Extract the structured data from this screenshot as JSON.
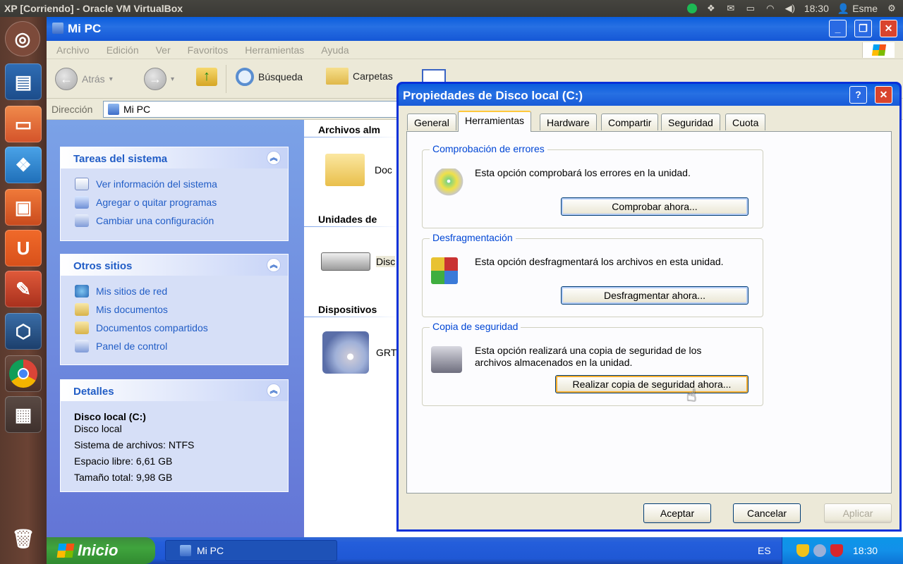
{
  "host": {
    "window_title": "XP [Corriendo] - Oracle VM VirtualBox",
    "clock": "18:30",
    "user": "Esme"
  },
  "explorer": {
    "title": "Mi PC",
    "menu": [
      "Archivo",
      "Edición",
      "Ver",
      "Favoritos",
      "Herramientas",
      "Ayuda"
    ],
    "toolbar": {
      "back": "Atrás",
      "search": "Búsqueda",
      "folders": "Carpetas"
    },
    "address_label": "Dirección",
    "address_value": "Mi PC",
    "panels": {
      "system_tasks": {
        "title": "Tareas del sistema",
        "items": [
          "Ver información del sistema",
          "Agregar o quitar programas",
          "Cambiar una configuración"
        ]
      },
      "other_places": {
        "title": "Otros sitios",
        "items": [
          "Mis sitios de red",
          "Mis documentos",
          "Documentos compartidos",
          "Panel de control"
        ]
      },
      "details": {
        "title": "Detalles",
        "name": "Disco local (C:)",
        "type": "Disco local",
        "fs": "Sistema de archivos: NTFS",
        "free": "Espacio libre: 6,61 GB",
        "total": "Tamaño total: 9,98 GB"
      }
    },
    "sections": {
      "stored_files": "Archivos alm",
      "stored_item": "Doc",
      "drives": "Unidades de",
      "drive_item": "Disc",
      "devices": "Dispositivos",
      "device_item": "GRT"
    }
  },
  "dialog": {
    "title": "Propiedades de Disco local (C:)",
    "tabs": [
      "General",
      "Herramientas",
      "Hardware",
      "Compartir",
      "Seguridad",
      "Cuota"
    ],
    "active_tab": "Herramientas",
    "groups": {
      "check": {
        "label": "Comprobación de errores",
        "text": "Esta opción comprobará los errores en la unidad.",
        "button": "Comprobar ahora..."
      },
      "defrag": {
        "label": "Desfragmentación",
        "text": "Esta opción desfragmentará los archivos en esta unidad.",
        "button": "Desfragmentar ahora..."
      },
      "backup": {
        "label": "Copia de seguridad",
        "text": "Esta opción realizará una copia de seguridad de los archivos almacenados en la unidad.",
        "button": "Realizar copia de seguridad ahora..."
      }
    },
    "buttons": {
      "ok": "Aceptar",
      "cancel": "Cancelar",
      "apply": "Aplicar"
    }
  },
  "taskbar": {
    "start": "Inicio",
    "task": "Mi PC",
    "lang": "ES",
    "clock": "18:30"
  }
}
